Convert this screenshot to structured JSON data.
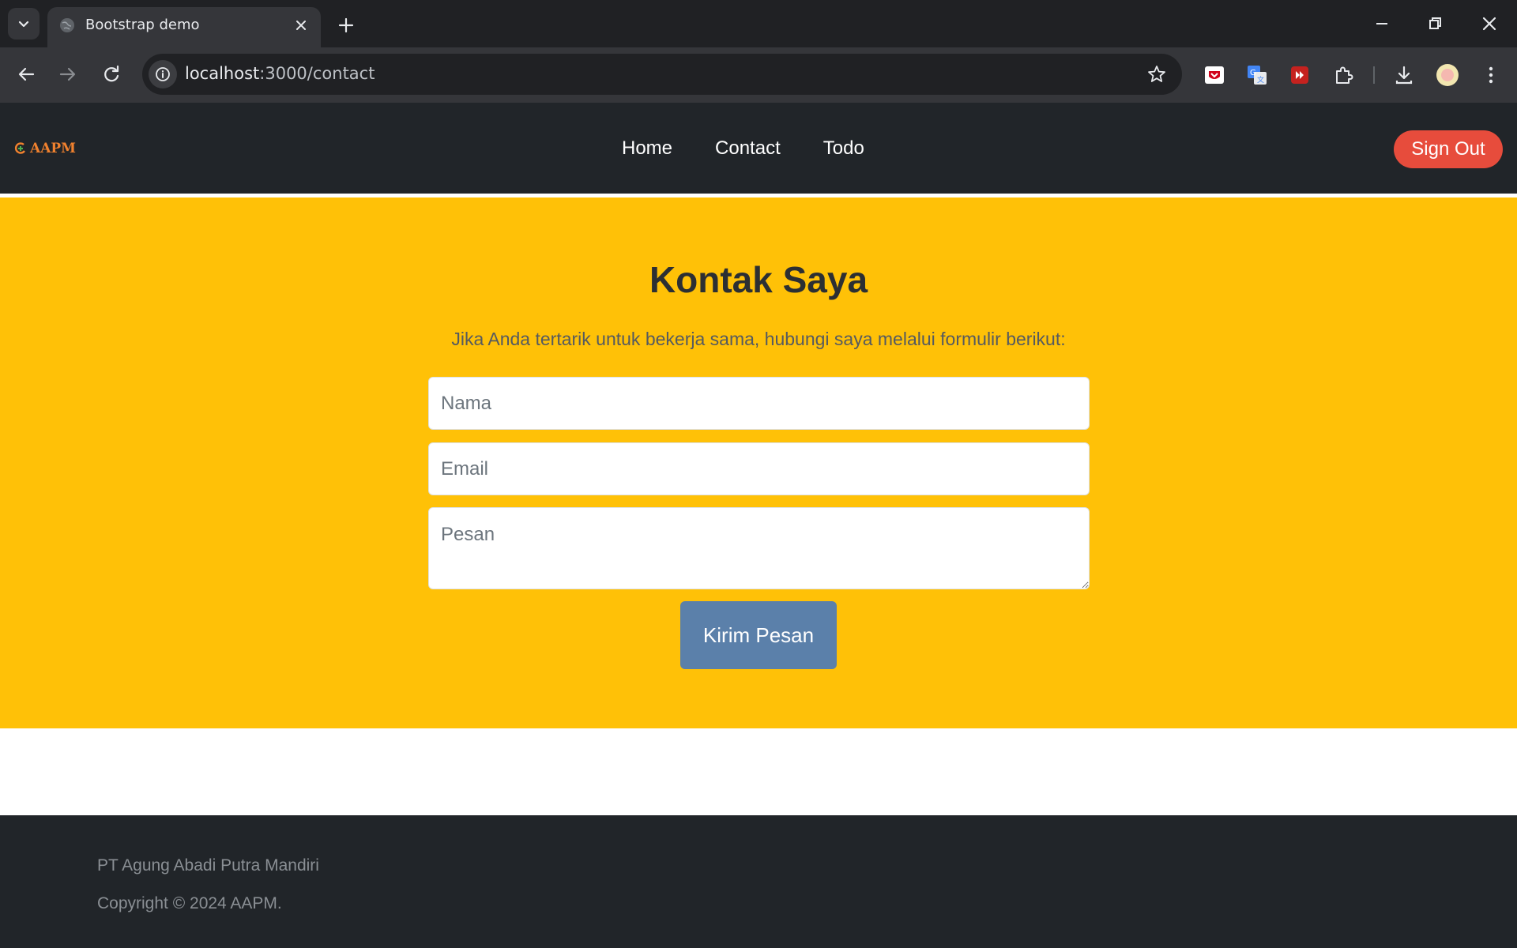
{
  "browser": {
    "tab_title": "Bootstrap demo",
    "url_host": "localhost",
    "url_path": ":3000/contact",
    "icons": [
      "tab-search-icon",
      "globe-icon",
      "close-icon",
      "plus-icon",
      "minimize-icon",
      "restore-icon",
      "window-close-icon",
      "back-icon",
      "forward-icon",
      "reload-icon",
      "info-icon",
      "star-icon",
      "pocket-icon",
      "translate-icon",
      "extension-icon",
      "puzzle-icon",
      "download-icon",
      "avatar",
      "kebab-menu-icon"
    ]
  },
  "navbar": {
    "brand": "AAPM",
    "links": [
      "Home",
      "Contact",
      "Todo"
    ],
    "signout_label": "Sign Out"
  },
  "contact": {
    "title": "Kontak Saya",
    "subtitle": "Jika Anda tertarik untuk bekerja sama, hubungi saya melalui formulir berikut:",
    "name_placeholder": "Nama",
    "email_placeholder": "Email",
    "message_placeholder": "Pesan",
    "submit_label": "Kirim Pesan"
  },
  "footer": {
    "company": "PT Agung Abadi Putra Mandiri",
    "copyright": "Copyright © 2024 AAPM."
  },
  "colors": {
    "navbar_bg": "#212529",
    "hero_bg": "#ffc107",
    "signout_bg": "#e74c3c",
    "submit_bg": "#5b80aa",
    "brand": "#f0812e"
  }
}
